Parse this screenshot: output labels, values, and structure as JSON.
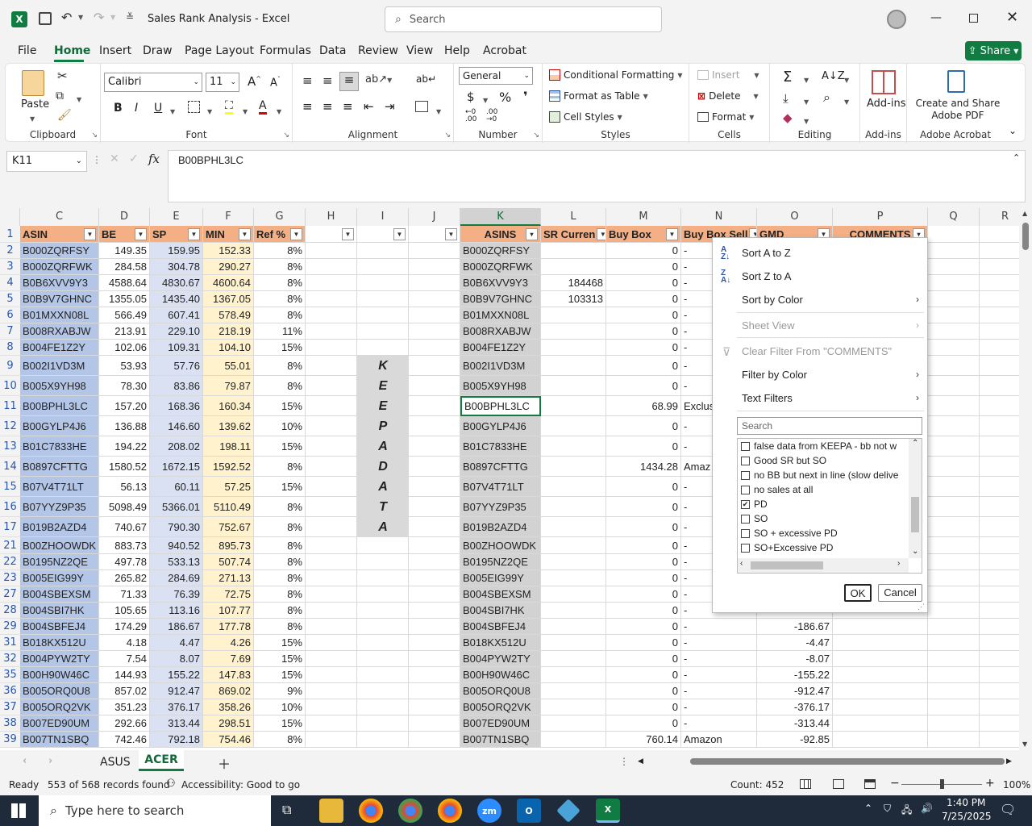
{
  "titlebar": {
    "doc_title": "Sales Rank Analysis  -  Excel",
    "search_placeholder": "Search"
  },
  "menu": {
    "tabs": [
      "File",
      "Home",
      "Insert",
      "Draw",
      "Page Layout",
      "Formulas",
      "Data",
      "Review",
      "View",
      "Help",
      "Acrobat"
    ],
    "active": "Home",
    "share": "Share"
  },
  "ribbon": {
    "paste": "Paste",
    "clipboard": "Clipboard",
    "font_name": "Calibri",
    "font_size": "11",
    "font": "Font",
    "alignment": "Alignment",
    "number_format": "General",
    "number": "Number",
    "cond_format": "Conditional Formatting",
    "format_table": "Format as Table",
    "cell_styles": "Cell Styles",
    "styles": "Styles",
    "insert": "Insert",
    "delete": "Delete",
    "format": "Format",
    "cells": "Cells",
    "editing": "Editing",
    "addins": "Add-ins",
    "addins_group": "Add-ins",
    "acrobat_btn": "Create and Share Adobe PDF",
    "acrobat_group": "Adobe Acrobat"
  },
  "formula": {
    "namebox": "K11",
    "content": "B00BPHL3LC"
  },
  "columns": [
    "C",
    "D",
    "E",
    "F",
    "G",
    "H",
    "I",
    "J",
    "K",
    "L",
    "M",
    "N",
    "O",
    "P",
    "Q",
    "R"
  ],
  "headers": {
    "C": "ASIN",
    "D": "BE",
    "E": "SP",
    "F": "MIN",
    "G": "Ref %",
    "K": "ASINS",
    "L": "SR Curren",
    "M": "Buy Box",
    "N": "Buy Box Sell",
    "O": "GMD",
    "P": "COMMENTS"
  },
  "keepa_text": [
    "K",
    "E",
    "E",
    "P",
    "A",
    "D",
    "A",
    "T",
    "A"
  ],
  "rows": [
    {
      "n": "1"
    },
    {
      "n": "2",
      "asin": "B000ZQRFSY",
      "be": "149.35",
      "sp": "159.95",
      "min": "152.33",
      "ref": "8%",
      "k": "B000ZQRFSY",
      "l": "",
      "m": "0",
      "nn": "-",
      "o": ""
    },
    {
      "n": "3",
      "asin": "B000ZQRFWK",
      "be": "284.58",
      "sp": "304.78",
      "min": "290.27",
      "ref": "8%",
      "k": "B000ZQRFWK",
      "l": "",
      "m": "0",
      "nn": "-",
      "o": ""
    },
    {
      "n": "4",
      "asin": "B0B6XVV9Y3",
      "be": "4588.64",
      "sp": "4830.67",
      "min": "4600.64",
      "ref": "8%",
      "k": "B0B6XVV9Y3",
      "l": "184468",
      "m": "0",
      "nn": "-",
      "o": ""
    },
    {
      "n": "5",
      "asin": "B0B9V7GHNC",
      "be": "1355.05",
      "sp": "1435.40",
      "min": "1367.05",
      "ref": "8%",
      "k": "B0B9V7GHNC",
      "l": "103313",
      "m": "0",
      "nn": "-",
      "o": ""
    },
    {
      "n": "6",
      "asin": "B01MXXN08L",
      "be": "566.49",
      "sp": "607.41",
      "min": "578.49",
      "ref": "8%",
      "k": "B01MXXN08L",
      "l": "",
      "m": "0",
      "nn": "-",
      "o": ""
    },
    {
      "n": "7",
      "asin": "B008RXABJW",
      "be": "213.91",
      "sp": "229.10",
      "min": "218.19",
      "ref": "11%",
      "k": "B008RXABJW",
      "l": "",
      "m": "0",
      "nn": "-",
      "o": ""
    },
    {
      "n": "8",
      "asin": "B004FE1Z2Y",
      "be": "102.06",
      "sp": "109.31",
      "min": "104.10",
      "ref": "15%",
      "k": "B004FE1Z2Y",
      "l": "",
      "m": "0",
      "nn": "-",
      "o": ""
    },
    {
      "n": "9",
      "asin": "B002I1VD3M",
      "be": "53.93",
      "sp": "57.76",
      "min": "55.01",
      "ref": "8%",
      "k": "B002I1VD3M",
      "l": "",
      "m": "0",
      "nn": "-",
      "o": ""
    },
    {
      "n": "10",
      "asin": "B005X9YH98",
      "be": "78.30",
      "sp": "83.86",
      "min": "79.87",
      "ref": "8%",
      "k": "B005X9YH98",
      "l": "",
      "m": "0",
      "nn": "-",
      "o": ""
    },
    {
      "n": "11",
      "asin": "B00BPHL3LC",
      "be": "157.20",
      "sp": "168.36",
      "min": "160.34",
      "ref": "15%",
      "k": "B00BPHL3LC",
      "l": "",
      "m": "68.99",
      "nn": "Exclus",
      "o": ""
    },
    {
      "n": "12",
      "asin": "B00GYLP4J6",
      "be": "136.88",
      "sp": "146.60",
      "min": "139.62",
      "ref": "10%",
      "k": "B00GYLP4J6",
      "l": "",
      "m": "0",
      "nn": "-",
      "o": ""
    },
    {
      "n": "13",
      "asin": "B01C7833HE",
      "be": "194.22",
      "sp": "208.02",
      "min": "198.11",
      "ref": "15%",
      "k": "B01C7833HE",
      "l": "",
      "m": "0",
      "nn": "-",
      "o": ""
    },
    {
      "n": "14",
      "asin": "B0897CFTTG",
      "be": "1580.52",
      "sp": "1672.15",
      "min": "1592.52",
      "ref": "8%",
      "k": "B0897CFTTG",
      "l": "",
      "m": "1434.28",
      "nn": "Amaz",
      "o": ""
    },
    {
      "n": "15",
      "asin": "B07V4T71LT",
      "be": "56.13",
      "sp": "60.11",
      "min": "57.25",
      "ref": "15%",
      "k": "B07V4T71LT",
      "l": "",
      "m": "0",
      "nn": "-",
      "o": ""
    },
    {
      "n": "16",
      "asin": "B07YYZ9P35",
      "be": "5098.49",
      "sp": "5366.01",
      "min": "5110.49",
      "ref": "8%",
      "k": "B07YYZ9P35",
      "l": "",
      "m": "0",
      "nn": "-",
      "o": ""
    },
    {
      "n": "17",
      "asin": "B019B2AZD4",
      "be": "740.67",
      "sp": "790.30",
      "min": "752.67",
      "ref": "8%",
      "k": "B019B2AZD4",
      "l": "",
      "m": "0",
      "nn": "-",
      "o": ""
    },
    {
      "n": "21",
      "asin": "B00ZHOOWDK",
      "be": "883.73",
      "sp": "940.52",
      "min": "895.73",
      "ref": "8%",
      "k": "B00ZHOOWDK",
      "l": "",
      "m": "0",
      "nn": "-",
      "o": ""
    },
    {
      "n": "22",
      "asin": "B0195NZ2QE",
      "be": "497.78",
      "sp": "533.13",
      "min": "507.74",
      "ref": "8%",
      "k": "B0195NZ2QE",
      "l": "",
      "m": "0",
      "nn": "-",
      "o": ""
    },
    {
      "n": "23",
      "asin": "B005EIG99Y",
      "be": "265.82",
      "sp": "284.69",
      "min": "271.13",
      "ref": "8%",
      "k": "B005EIG99Y",
      "l": "",
      "m": "0",
      "nn": "-",
      "o": ""
    },
    {
      "n": "27",
      "asin": "B004SBEXSM",
      "be": "71.33",
      "sp": "76.39",
      "min": "72.75",
      "ref": "8%",
      "k": "B004SBEXSM",
      "l": "",
      "m": "0",
      "nn": "-",
      "o": ""
    },
    {
      "n": "28",
      "asin": "B004SBI7HK",
      "be": "105.65",
      "sp": "113.16",
      "min": "107.77",
      "ref": "8%",
      "k": "B004SBI7HK",
      "l": "",
      "m": "0",
      "nn": "-",
      "o": ""
    },
    {
      "n": "29",
      "asin": "B004SBFEJ4",
      "be": "174.29",
      "sp": "186.67",
      "min": "177.78",
      "ref": "8%",
      "k": "B004SBFEJ4",
      "l": "",
      "m": "0",
      "nn": "-",
      "o": "-186.67"
    },
    {
      "n": "31",
      "asin": "B018KX512U",
      "be": "4.18",
      "sp": "4.47",
      "min": "4.26",
      "ref": "15%",
      "k": "B018KX512U",
      "l": "",
      "m": "0",
      "nn": "-",
      "o": "-4.47"
    },
    {
      "n": "32",
      "asin": "B004PYW2TY",
      "be": "7.54",
      "sp": "8.07",
      "min": "7.69",
      "ref": "15%",
      "k": "B004PYW2TY",
      "l": "",
      "m": "0",
      "nn": "-",
      "o": "-8.07"
    },
    {
      "n": "35",
      "asin": "B00H90W46C",
      "be": "144.93",
      "sp": "155.22",
      "min": "147.83",
      "ref": "15%",
      "k": "B00H90W46C",
      "l": "",
      "m": "0",
      "nn": "-",
      "o": "-155.22"
    },
    {
      "n": "36",
      "asin": "B005ORQ0U8",
      "be": "857.02",
      "sp": "912.47",
      "min": "869.02",
      "ref": "9%",
      "k": "B005ORQ0U8",
      "l": "",
      "m": "0",
      "nn": "-",
      "o": "-912.47"
    },
    {
      "n": "37",
      "asin": "B005ORQ2VK",
      "be": "351.23",
      "sp": "376.17",
      "min": "358.26",
      "ref": "10%",
      "k": "B005ORQ2VK",
      "l": "",
      "m": "0",
      "nn": "-",
      "o": "-376.17"
    },
    {
      "n": "38",
      "asin": "B007ED90UM",
      "be": "292.66",
      "sp": "313.44",
      "min": "298.51",
      "ref": "15%",
      "k": "B007ED90UM",
      "l": "",
      "m": "0",
      "nn": "-",
      "o": "-313.44"
    },
    {
      "n": "39",
      "asin": "B007TN1SBQ",
      "be": "742.46",
      "sp": "792.18",
      "min": "754.46",
      "ref": "8%",
      "k": "B007TN1SBQ",
      "l": "",
      "m": "760.14",
      "nn": "Amazon",
      "o": "-92.85"
    }
  ],
  "filter_menu": {
    "sort_az": "Sort A to Z",
    "sort_za": "Sort Z to A",
    "sort_color": "Sort by Color",
    "sheet_view": "Sheet View",
    "clear_filter": "Clear Filter From \"COMMENTS\"",
    "filter_color": "Filter by Color",
    "text_filters": "Text Filters",
    "search_placeholder": "Search",
    "items": [
      {
        "label": "false data from KEEPA - bb not w",
        "checked": false
      },
      {
        "label": "Good SR but SO",
        "checked": false
      },
      {
        "label": "no BB but next in line (slow delive",
        "checked": false
      },
      {
        "label": "no sales at all",
        "checked": false
      },
      {
        "label": "PD",
        "checked": true
      },
      {
        "label": "SO",
        "checked": false
      },
      {
        "label": "SO + excessive PD",
        "checked": false
      },
      {
        "label": "SO+Excessive PD",
        "checked": false
      }
    ],
    "ok": "OK",
    "cancel": "Cancel"
  },
  "sheet_tabs": {
    "tabs": [
      "ASUS",
      "ACER"
    ],
    "active": "ACER"
  },
  "status": {
    "ready": "Ready",
    "records": "553 of 568 records found",
    "accessibility": "Accessibility: Good to go",
    "count": "Count: 452",
    "zoom": "100%"
  },
  "taskbar": {
    "search_placeholder": "Type here to search",
    "time": "1:40 PM",
    "date": "7/25/2025"
  },
  "colors": {
    "header_orange": "#f4b084",
    "asin_blue": "#b4c6e7",
    "sp_lavender": "#d9e1f2",
    "min_yellow": "#fff2cc",
    "keepa_gray": "#d9d9d9",
    "excel_green": "#107c41"
  }
}
